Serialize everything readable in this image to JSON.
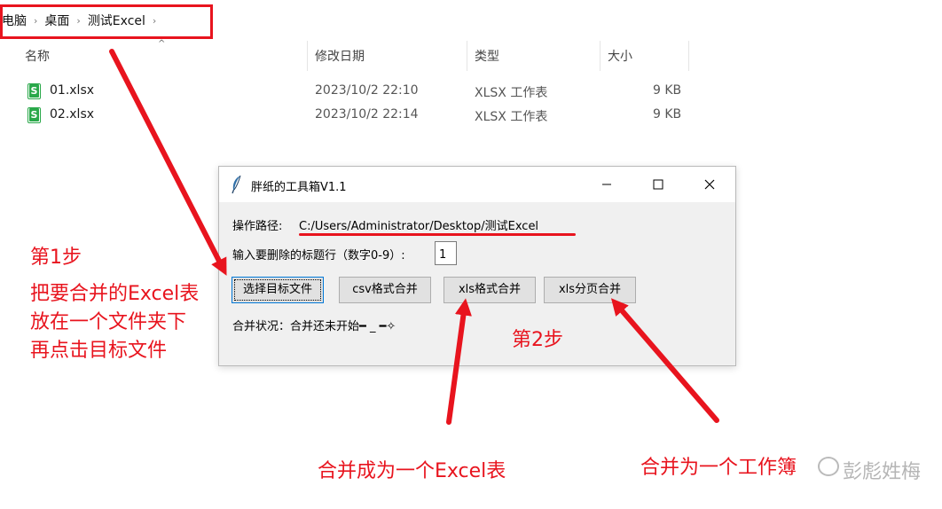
{
  "breadcrumb": [
    "电脑",
    "桌面",
    "测试Excel"
  ],
  "columns": [
    "名称",
    "修改日期",
    "类型",
    "大小"
  ],
  "files": [
    {
      "name": "01.xlsx",
      "modified": "2023/10/2 22:10",
      "type": "XLSX 工作表",
      "size": "9 KB"
    },
    {
      "name": "02.xlsx",
      "modified": "2023/10/2 22:14",
      "type": "XLSX 工作表",
      "size": "9 KB"
    }
  ],
  "tk_window": {
    "title": "胖纸的工具箱V1.1",
    "path_label": "操作路径:",
    "path_value": "C:/Users/Administrator/Desktop/测试Excel",
    "rows_label": "输入要删除的标题行（数字0-9）:",
    "rows_value": "1",
    "buttons": {
      "select": "选择目标文件",
      "csv": "csv格式合并",
      "xls": "xls格式合并",
      "xls_pages": "xls分页合并"
    },
    "status": "合并状况：合并还未开始━ _ ━✧"
  },
  "annotations": {
    "step1_title": "第1步",
    "step1_line1": "把要合并的Excel表",
    "step1_line2": "放在一个文件夹下",
    "step1_line3": "再点击目标文件",
    "step2": "第2步",
    "merge_one": "合并成为一个Excel表",
    "merge_sheets": "合并为一个工作簿"
  },
  "watermark": "彭彪姓梅",
  "colors": {
    "annotation_red": "#e8141e",
    "excel_green": "#2aa84a"
  }
}
